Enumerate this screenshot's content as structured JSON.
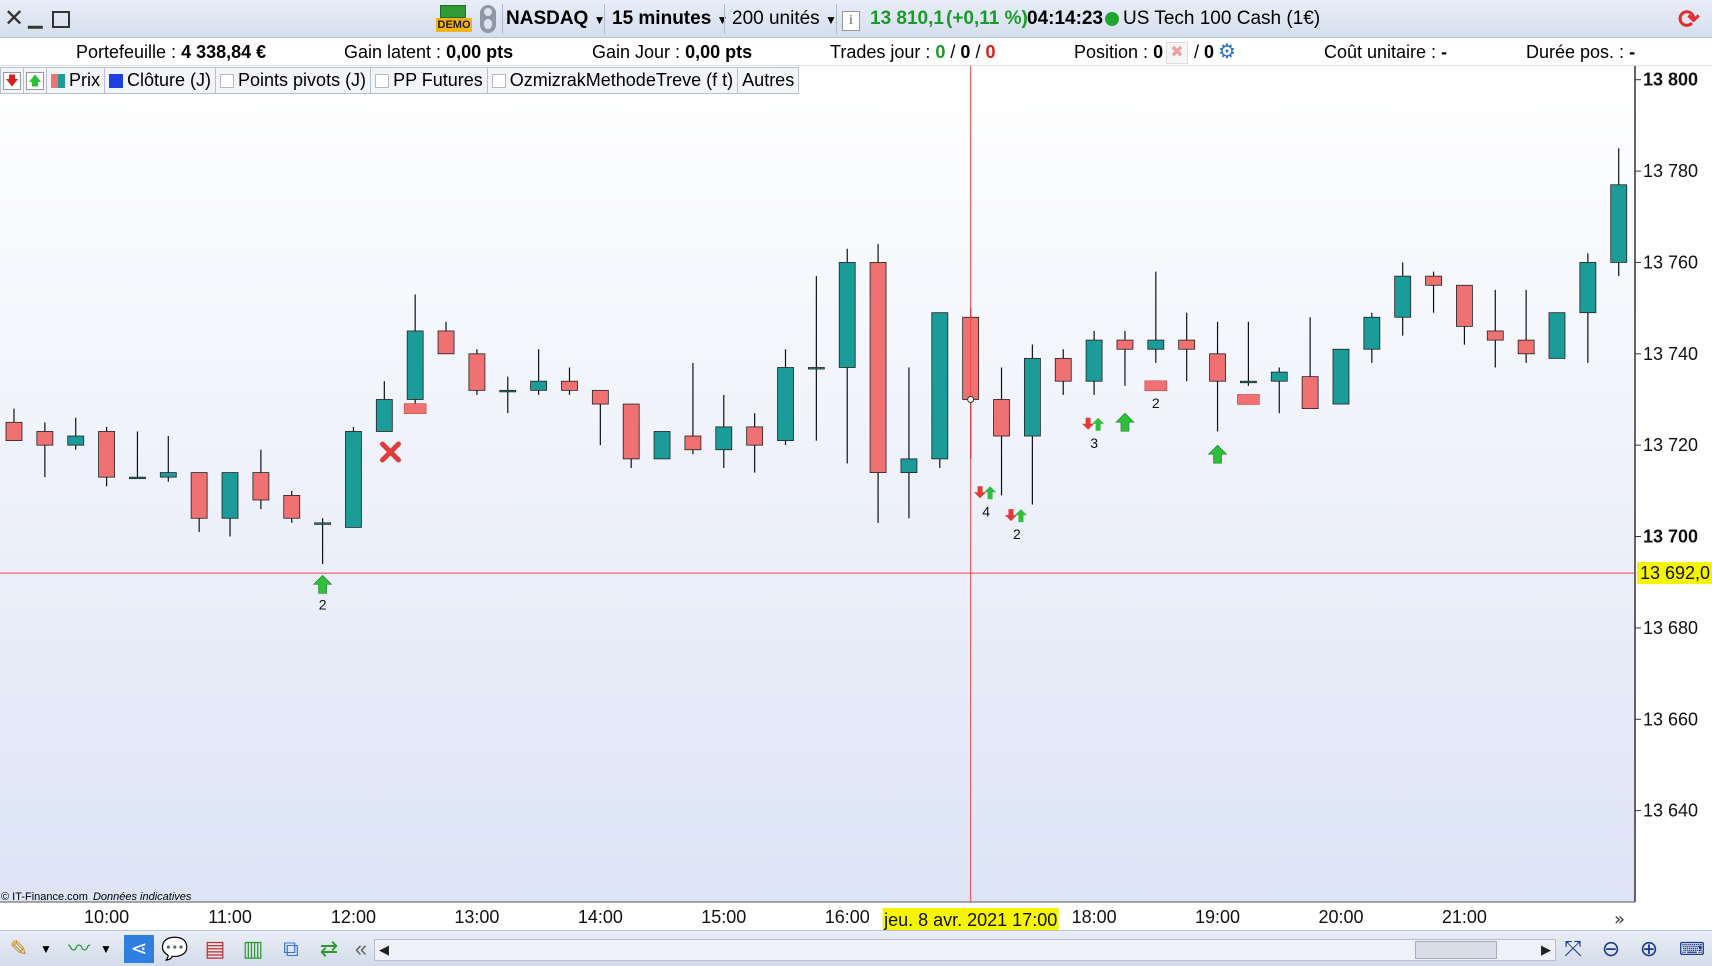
{
  "toolbar": {
    "demo_label": "DEMO",
    "instrument": "NASDAQ",
    "timeframe": "15 minutes",
    "units": "200 unités",
    "info_icon": "i",
    "price_value": "13 810,1",
    "price_change": "(+0,11 %)",
    "time": "04:14:23",
    "instrument_name": "US Tech 100 Cash (1€)"
  },
  "infobar": {
    "portfolio_label": "Portefeuille :",
    "portfolio_value": "4 338,84 €",
    "gain_latent_label": "Gain latent :",
    "gain_latent_value": "0,00 pts",
    "gain_jour_label": "Gain Jour :",
    "gain_jour_value": "0,00 pts",
    "trades_label": "Trades jour :",
    "trades_a": "0",
    "trades_b": "0",
    "trades_c": "0",
    "position_label": "Position :",
    "position_a": "0",
    "position_b": "0",
    "cout_label": "Coût unitaire :",
    "cout_value": "-",
    "duree_label": "Durée pos. :",
    "duree_value": "-"
  },
  "legend": {
    "prix": "Prix",
    "cloture": "Clôture (J)",
    "pivots": "Points pivots (J)",
    "pp_futures": "PP Futures",
    "ozmi": "OzmizrakMethodeTreve (f t)",
    "autres": "Autres"
  },
  "footer": {
    "copyright": "© IT-Finance.com",
    "indicative": "Données indicatives"
  },
  "colors": {
    "bull": "#1c9c98",
    "bear": "#f07171",
    "crosshair": "#ee4444",
    "date_label_bg": "#f5f500",
    "buy_arrow": "#2fbf3a",
    "sell_arrow": "#e23b3b",
    "background_top": "#ffffff",
    "background_bottom": "#dde4f6"
  },
  "chart_data": {
    "type": "candlestick",
    "symbol": "NASDAQ",
    "interval": "15 minutes",
    "ylim": [
      13620,
      13803
    ],
    "y_ticks": [
      13800,
      13780,
      13760,
      13740,
      13720,
      13700,
      13680,
      13660,
      13640
    ],
    "y_tick_labels": [
      "13 800",
      "13 780",
      "13 760",
      "13 740",
      "13 720",
      "13 700",
      "13 680",
      "13 660",
      "13 640"
    ],
    "y_tick_bold": [
      "13 800",
      "13 700"
    ],
    "x_ticks": [
      "10:00",
      "11:00",
      "12:00",
      "13:00",
      "14:00",
      "15:00",
      "16:00",
      "17:00",
      "18:00",
      "19:00",
      "20:00",
      "21:00"
    ],
    "crosshair": {
      "time": "17:00",
      "date_label": "jeu. 8 avr. 2021 17:00",
      "price": 13692.0,
      "price_label": "13 692,0"
    },
    "candles": [
      {
        "t": "09:15",
        "o": 13725,
        "h": 13728,
        "l": 13721,
        "c": 13721
      },
      {
        "t": "09:30",
        "o": 13723,
        "h": 13725,
        "l": 13713,
        "c": 13720
      },
      {
        "t": "09:45",
        "o": 13720,
        "h": 13726,
        "l": 13719,
        "c": 13722
      },
      {
        "t": "10:00",
        "o": 13723,
        "h": 13724,
        "l": 13711,
        "c": 13713
      },
      {
        "t": "10:15",
        "o": 13713,
        "h": 13723,
        "l": 13713,
        "c": 13713
      },
      {
        "t": "10:30",
        "o": 13713,
        "h": 13722,
        "l": 13712,
        "c": 13714
      },
      {
        "t": "10:45",
        "o": 13714,
        "h": 13714,
        "l": 13701,
        "c": 13704
      },
      {
        "t": "11:00",
        "o": 13704,
        "h": 13714,
        "l": 13700,
        "c": 13714
      },
      {
        "t": "11:15",
        "o": 13714,
        "h": 13719,
        "l": 13706,
        "c": 13708
      },
      {
        "t": "11:30",
        "o": 13709,
        "h": 13710,
        "l": 13703,
        "c": 13704
      },
      {
        "t": "11:45",
        "o": 13703,
        "h": 13704,
        "l": 13694,
        "c": 13703
      },
      {
        "t": "12:00",
        "o": 13702,
        "h": 13724,
        "l": 13702,
        "c": 13723
      },
      {
        "t": "12:15",
        "o": 13723,
        "h": 13734,
        "l": 13723,
        "c": 13730
      },
      {
        "t": "12:30",
        "o": 13730,
        "h": 13753,
        "l": 13729,
        "c": 13745
      },
      {
        "t": "12:45",
        "o": 13745,
        "h": 13747,
        "l": 13740,
        "c": 13740
      },
      {
        "t": "13:00",
        "o": 13740,
        "h": 13741,
        "l": 13731,
        "c": 13732
      },
      {
        "t": "13:15",
        "o": 13732,
        "h": 13735,
        "l": 13727,
        "c": 13732
      },
      {
        "t": "13:30",
        "o": 13732,
        "h": 13741,
        "l": 13731,
        "c": 13734
      },
      {
        "t": "13:45",
        "o": 13734,
        "h": 13737,
        "l": 13731,
        "c": 13732
      },
      {
        "t": "14:00",
        "o": 13732,
        "h": 13732,
        "l": 13720,
        "c": 13729
      },
      {
        "t": "14:15",
        "o": 13729,
        "h": 13729,
        "l": 13715,
        "c": 13717
      },
      {
        "t": "14:30",
        "o": 13717,
        "h": 13723,
        "l": 13717,
        "c": 13723
      },
      {
        "t": "14:45",
        "o": 13722,
        "h": 13738,
        "l": 13718,
        "c": 13719
      },
      {
        "t": "15:00",
        "o": 13719,
        "h": 13731,
        "l": 13715,
        "c": 13724
      },
      {
        "t": "15:15",
        "o": 13724,
        "h": 13727,
        "l": 13714,
        "c": 13720
      },
      {
        "t": "15:30",
        "o": 13721,
        "h": 13741,
        "l": 13720,
        "c": 13737
      },
      {
        "t": "15:45",
        "o": 13737,
        "h": 13757,
        "l": 13721,
        "c": 13737
      },
      {
        "t": "16:00",
        "o": 13737,
        "h": 13763,
        "l": 13716,
        "c": 13760
      },
      {
        "t": "16:15",
        "o": 13760,
        "h": 13764,
        "l": 13703,
        "c": 13714
      },
      {
        "t": "16:30",
        "o": 13714,
        "h": 13737,
        "l": 13704,
        "c": 13717
      },
      {
        "t": "16:45",
        "o": 13717,
        "h": 13749,
        "l": 13715,
        "c": 13749
      },
      {
        "t": "17:00",
        "o": 13748,
        "h": 13750,
        "l": 13717,
        "c": 13730
      },
      {
        "t": "17:15",
        "o": 13730,
        "h": 13737,
        "l": 13709,
        "c": 13722
      },
      {
        "t": "17:30",
        "o": 13722,
        "h": 13742,
        "l": 13707,
        "c": 13739
      },
      {
        "t": "17:45",
        "o": 13739,
        "h": 13741,
        "l": 13731,
        "c": 13734
      },
      {
        "t": "18:00",
        "o": 13734,
        "h": 13745,
        "l": 13731,
        "c": 13743
      },
      {
        "t": "18:15",
        "o": 13743,
        "h": 13745,
        "l": 13733,
        "c": 13741
      },
      {
        "t": "18:30",
        "o": 13741,
        "h": 13758,
        "l": 13738,
        "c": 13743
      },
      {
        "t": "18:45",
        "o": 13743,
        "h": 13749,
        "l": 13734,
        "c": 13741
      },
      {
        "t": "19:00",
        "o": 13740,
        "h": 13747,
        "l": 13723,
        "c": 13734
      },
      {
        "t": "19:15",
        "o": 13734,
        "h": 13747,
        "l": 13733,
        "c": 13734
      },
      {
        "t": "19:30",
        "o": 13734,
        "h": 13737,
        "l": 13727,
        "c": 13736
      },
      {
        "t": "19:45",
        "o": 13735,
        "h": 13748,
        "l": 13728,
        "c": 13728
      },
      {
        "t": "20:00",
        "o": 13729,
        "h": 13741,
        "l": 13729,
        "c": 13741
      },
      {
        "t": "20:15",
        "o": 13741,
        "h": 13749,
        "l": 13738,
        "c": 13748
      },
      {
        "t": "20:30",
        "o": 13748,
        "h": 13760,
        "l": 13744,
        "c": 13757
      },
      {
        "t": "20:45",
        "o": 13757,
        "h": 13758,
        "l": 13749,
        "c": 13755
      },
      {
        "t": "21:00",
        "o": 13755,
        "h": 13755,
        "l": 13742,
        "c": 13746
      },
      {
        "t": "21:15",
        "o": 13745,
        "h": 13754,
        "l": 13737,
        "c": 13743
      },
      {
        "t": "21:30",
        "o": 13743,
        "h": 13754,
        "l": 13738,
        "c": 13740
      },
      {
        "t": "21:45",
        "o": 13739,
        "h": 13749,
        "l": 13739,
        "c": 13749
      },
      {
        "t": "22:00",
        "o": 13749,
        "h": 13762,
        "l": 13738,
        "c": 13760
      },
      {
        "t": "22:15",
        "o": 13760,
        "h": 13785,
        "l": 13757,
        "c": 13777
      }
    ],
    "markers": [
      {
        "idx": 10.0,
        "price": 13691.5,
        "kind": "buy",
        "label": "2"
      },
      {
        "idx": 12.2,
        "price": 13718.5,
        "kind": "x"
      },
      {
        "idx": 13.0,
        "price": 13728.0,
        "kind": "rect"
      },
      {
        "idx": 31.5,
        "price": 13711.0,
        "kind": "sellbuy",
        "label": "4"
      },
      {
        "idx": 32.5,
        "price": 13706.0,
        "kind": "sellbuy",
        "label": "2"
      },
      {
        "idx": 35.0,
        "price": 13726.0,
        "kind": "sellbuy",
        "label": "3"
      },
      {
        "idx": 36.0,
        "price": 13727.0,
        "kind": "buy"
      },
      {
        "idx": 37.0,
        "price": 13733.0,
        "kind": "rect",
        "label": "2"
      },
      {
        "idx": 39.0,
        "price": 13720.0,
        "kind": "buy"
      },
      {
        "idx": 40.0,
        "price": 13730.0,
        "kind": "rect"
      }
    ]
  }
}
